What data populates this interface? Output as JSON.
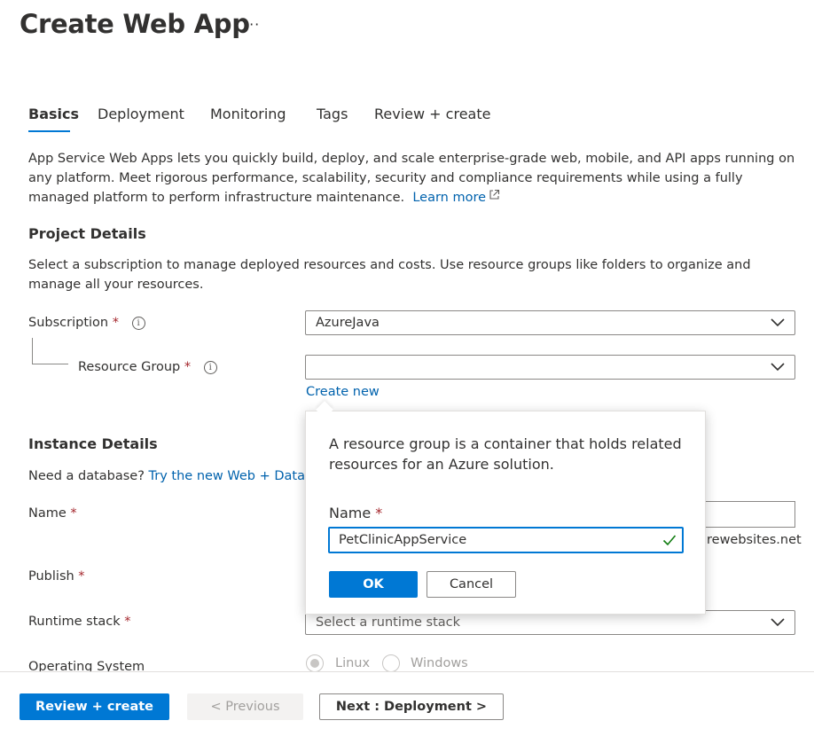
{
  "header": {
    "title": "Create Web App",
    "more_label": "···"
  },
  "tabs": [
    {
      "label": "Basics",
      "active": true
    },
    {
      "label": "Deployment",
      "active": false
    },
    {
      "label": "Monitoring",
      "active": false
    },
    {
      "label": "Tags",
      "active": false
    },
    {
      "label": "Review + create",
      "active": false
    }
  ],
  "intro": {
    "text": "App Service Web Apps lets you quickly build, deploy, and scale enterprise-grade web, mobile, and API apps running on any platform. Meet rigorous performance, scalability, security and compliance requirements while using a fully managed platform to perform infrastructure maintenance.",
    "learn_more": "Learn more"
  },
  "project_details": {
    "title": "Project Details",
    "description": "Select a subscription to manage deployed resources and costs. Use resource groups like folders to organize and manage all your resources.",
    "subscription_label": "Subscription",
    "subscription_value": "AzureJava",
    "resource_group_label": "Resource Group",
    "resource_group_value": "",
    "create_new": "Create new"
  },
  "instance_details": {
    "title": "Instance Details",
    "need_db": "Need a database?",
    "try_link": "Try the new Web + Datab",
    "name_label": "Name",
    "name_suffix": "rewebsites.net",
    "publish_label": "Publish",
    "runtime_label": "Runtime stack",
    "runtime_placeholder": "Select a runtime stack",
    "os_label": "Operating System",
    "os_options": [
      "Linux",
      "Windows"
    ]
  },
  "required_mark": "*",
  "info_glyph": "i",
  "popup": {
    "text": "A resource group is a container that holds related resources for an Azure solution.",
    "name_label": "Name",
    "name_value": "PetClinicAppService",
    "ok_label": "OK",
    "cancel_label": "Cancel"
  },
  "footer": {
    "review_create": "Review + create",
    "previous": "< Previous",
    "next": "Next : Deployment >"
  },
  "colors": {
    "accent": "#0078d4",
    "link": "#0062ad",
    "required": "#a4262c",
    "valid": "#107c10"
  }
}
